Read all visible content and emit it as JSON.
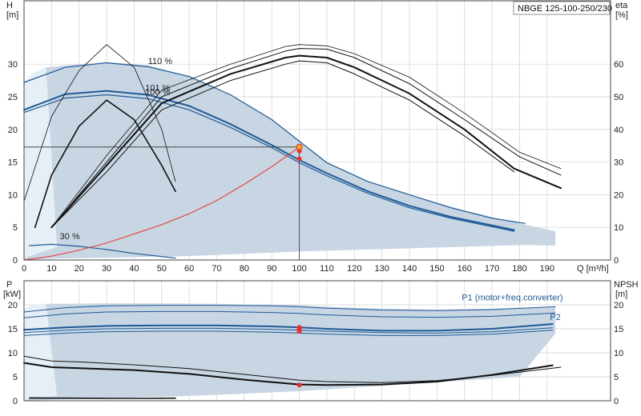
{
  "title": "NBGE 125-100-250/230",
  "colors": {
    "band_fill": "#c8d6e4",
    "band_light": "#e6eef6",
    "blue": "#1f5a96",
    "black": "#111111",
    "red": "#e8302a",
    "grid": "#d0d0d0",
    "op_point": "#f0b020"
  },
  "chart_data": [
    {
      "type": "line",
      "panel": "head_eta",
      "xlabel": "Q [m³/h]",
      "ylabel_left": [
        "H",
        "[m]"
      ],
      "ylabel_right": [
        "eta",
        "[%]"
      ],
      "xlim": [
        0,
        95
      ],
      "ylim_left": [
        0,
        39.7
      ],
      "ylim_right": [
        0,
        79.4
      ],
      "x_ticks": [
        0,
        10,
        20,
        30,
        40,
        50,
        60,
        70,
        80,
        90,
        100,
        110,
        120,
        130,
        140,
        150,
        160,
        170,
        180,
        190
      ],
      "y_ticks_left": [
        0,
        5,
        10,
        15,
        20,
        25,
        30
      ],
      "y_ticks_right": [
        0,
        10,
        20,
        30,
        40,
        50,
        60
      ],
      "grid": true,
      "curve_labels": [
        {
          "text": "110 %",
          "x": 45,
          "y": 30.0
        },
        {
          "text": "101 %",
          "x": 44,
          "y": 25.9
        },
        {
          "text": "100 %",
          "x": 44,
          "y": 25.3
        },
        {
          "text": "30 %",
          "x": 13,
          "y": 3.2
        }
      ],
      "operating_point": {
        "x": 100,
        "y": 17.3
      },
      "duty_markers": [
        {
          "x": 100,
          "y": 16.7
        },
        {
          "x": 100,
          "y": 15.5
        }
      ],
      "series": [
        {
          "role": "band",
          "x": [
            0,
            3,
            8,
            15,
            30,
            45,
            60,
            75,
            90,
            100,
            110,
            125,
            140,
            160,
            180,
            193,
            193,
            182,
            100,
            60,
            10,
            5,
            0
          ],
          "y": [
            27.2,
            28.5,
            29.5,
            29.8,
            30.3,
            29.8,
            28.2,
            25.3,
            21.5,
            18.2,
            14.9,
            12.0,
            10.0,
            7.6,
            5.6,
            4.4,
            2.2,
            2.3,
            1.3,
            0.6,
            0.2,
            0.1,
            0
          ]
        },
        {
          "role": "band_light",
          "x": [
            0,
            3,
            8,
            12,
            0
          ],
          "y": [
            27.2,
            28.5,
            29.5,
            2.0,
            0.3
          ]
        },
        {
          "role": "head",
          "color": "blue",
          "width": 1.2,
          "x": [
            0,
            15,
            30,
            45,
            60,
            75,
            90,
            100,
            110,
            125,
            140,
            155,
            170,
            182
          ],
          "y": [
            27.2,
            29.5,
            30.2,
            29.6,
            28.1,
            25.3,
            21.5,
            18.2,
            14.9,
            12.0,
            10.0,
            8.0,
            6.4,
            5.6
          ]
        },
        {
          "role": "head",
          "color": "blue",
          "width": 2.0,
          "x": [
            0,
            15,
            30,
            45,
            60,
            75,
            90,
            100,
            110,
            125,
            140,
            155,
            170,
            178
          ],
          "y": [
            23.0,
            25.4,
            25.9,
            25.3,
            23.6,
            20.8,
            17.6,
            15.3,
            13.3,
            10.5,
            8.3,
            6.6,
            5.3,
            4.6
          ]
        },
        {
          "role": "head",
          "color": "blue",
          "width": 1.2,
          "x": [
            0,
            15,
            30,
            45,
            60,
            75,
            90,
            100,
            110,
            125,
            140,
            155,
            170,
            178
          ],
          "y": [
            22.6,
            24.8,
            25.3,
            24.7,
            23.0,
            20.3,
            17.2,
            14.9,
            12.9,
            10.2,
            8.0,
            6.4,
            5.1,
            4.4
          ]
        },
        {
          "role": "head",
          "color": "blue",
          "width": 1.2,
          "x": [
            2,
            10,
            20,
            30,
            40,
            55
          ],
          "y": [
            2.2,
            2.4,
            2.1,
            1.6,
            1.0,
            0.3
          ]
        },
        {
          "role": "eta",
          "color": "black",
          "width": 0.8,
          "x": [
            0,
            10,
            20,
            30,
            40,
            50,
            55
          ],
          "y": [
            9.0,
            22.0,
            29.0,
            33.0,
            29.5,
            20.0,
            12.0
          ]
        },
        {
          "role": "eta",
          "color": "black",
          "width": 1.6,
          "x": [
            4,
            10,
            20,
            30,
            40,
            50,
            55
          ],
          "y": [
            5.0,
            13.0,
            20.5,
            24.5,
            21.5,
            14.5,
            10.5
          ]
        },
        {
          "role": "eta",
          "color": "black",
          "width": 0.8,
          "x": [
            10,
            30,
            50,
            75,
            95,
            100,
            110,
            120,
            140,
            160,
            180,
            195
          ],
          "y": [
            5.0,
            16.0,
            26.0,
            30.0,
            32.7,
            33.0,
            32.8,
            31.6,
            28.0,
            22.5,
            16.5,
            14.0
          ]
        },
        {
          "role": "eta",
          "color": "black",
          "width": 1.0,
          "x": [
            10,
            30,
            50,
            75,
            95,
            100,
            110,
            120,
            140,
            160,
            180,
            195
          ],
          "y": [
            5.0,
            15.0,
            25.0,
            29.3,
            32.0,
            32.4,
            32.3,
            31.0,
            27.0,
            21.5,
            15.8,
            13.0
          ]
        },
        {
          "role": "eta",
          "color": "black",
          "width": 2.0,
          "x": [
            10,
            30,
            50,
            75,
            95,
            100,
            110,
            120,
            140,
            160,
            178,
            195
          ],
          "y": [
            5.0,
            14.5,
            24.0,
            28.5,
            31.0,
            31.3,
            31.0,
            29.5,
            25.5,
            20.0,
            14.0,
            11.0
          ]
        },
        {
          "role": "eta",
          "color": "black",
          "width": 1.0,
          "x": [
            10,
            30,
            50,
            75,
            95,
            100,
            110,
            120,
            140,
            160,
            178
          ],
          "y": [
            5.0,
            13.5,
            23.0,
            27.5,
            30.0,
            30.5,
            30.2,
            28.5,
            24.5,
            19.0,
            13.5
          ]
        },
        {
          "role": "system",
          "color": "red",
          "width": 1.0,
          "x": [
            0,
            10,
            20,
            30,
            40,
            50,
            60,
            70,
            80,
            90,
            100
          ],
          "y": [
            0,
            0.6,
            1.5,
            2.6,
            4.0,
            5.4,
            7.1,
            9.1,
            11.6,
            14.3,
            17.3
          ]
        }
      ]
    },
    {
      "type": "line",
      "panel": "power_npsh",
      "xlabel": "Q [m³/h]",
      "ylabel_left": [
        "P",
        "[kW]"
      ],
      "ylabel_right": [
        "NPSH",
        "[m]"
      ],
      "xlim": [
        0,
        95
      ],
      "ylim_left": [
        0,
        25
      ],
      "ylim_right": [
        0,
        25
      ],
      "y_ticks_left": [
        0,
        5,
        10,
        15,
        20
      ],
      "y_ticks_right": [
        0,
        5,
        10,
        15,
        20
      ],
      "grid": true,
      "curve_labels": [
        {
          "text": "P1 (motor+freq.converter)",
          "x": 159,
          "y": 20.9
        },
        {
          "text": "P2",
          "x": 191,
          "y": 16.8
        }
      ],
      "duty_markers": [
        {
          "x": 100,
          "y": 15.3
        },
        {
          "x": 100,
          "y": 14.9
        },
        {
          "x": 100,
          "y": 14.5
        },
        {
          "x": 100,
          "y": 3.3
        }
      ],
      "series": [
        {
          "role": "band",
          "x": [
            0,
            3,
            8,
            15,
            30,
            50,
            70,
            90,
            100,
            110,
            130,
            150,
            170,
            193,
            193,
            180,
            100,
            60,
            10,
            0
          ],
          "y": [
            19.0,
            20.0,
            20.2,
            20.2,
            20.3,
            20.3,
            20.2,
            20.0,
            19.9,
            19.6,
            19.2,
            19.0,
            19.2,
            19.6,
            14.0,
            5.0,
            2.0,
            1.0,
            0.2,
            0
          ]
        },
        {
          "role": "band_light",
          "x": [
            0,
            3,
            8,
            12,
            0
          ],
          "y": [
            19.0,
            20.0,
            20.2,
            1.0,
            0.2
          ]
        },
        {
          "role": "power",
          "color": "blue",
          "width": 1.0,
          "x": [
            0,
            15,
            30,
            50,
            70,
            90,
            100,
            110,
            130,
            150,
            170,
            193
          ],
          "y": [
            18.5,
            19.4,
            19.8,
            19.9,
            19.9,
            19.8,
            19.6,
            19.3,
            18.9,
            18.8,
            19.0,
            19.6
          ]
        },
        {
          "role": "power",
          "color": "blue",
          "width": 1.0,
          "x": [
            0,
            15,
            30,
            50,
            70,
            90,
            100,
            110,
            130,
            150,
            170,
            193
          ],
          "y": [
            17.3,
            18.1,
            18.5,
            18.6,
            18.6,
            18.4,
            18.2,
            17.9,
            17.5,
            17.4,
            17.6,
            18.3
          ]
        },
        {
          "role": "power",
          "color": "blue",
          "width": 2.0,
          "x": [
            0,
            15,
            30,
            50,
            70,
            90,
            100,
            110,
            130,
            150,
            170,
            192
          ],
          "y": [
            14.8,
            15.3,
            15.6,
            15.7,
            15.7,
            15.5,
            15.3,
            15.0,
            14.6,
            14.6,
            15.0,
            16.0
          ]
        },
        {
          "role": "power",
          "color": "blue",
          "width": 1.0,
          "x": [
            0,
            15,
            30,
            50,
            70,
            90,
            100,
            110,
            130,
            150,
            170,
            192
          ],
          "y": [
            14.2,
            14.7,
            15.0,
            15.1,
            15.1,
            14.9,
            14.7,
            14.5,
            14.2,
            14.1,
            14.4,
            15.2
          ]
        },
        {
          "role": "power",
          "color": "blue",
          "width": 1.0,
          "x": [
            0,
            15,
            30,
            50,
            70,
            90,
            100,
            110,
            130,
            150,
            170,
            192
          ],
          "y": [
            13.6,
            14.1,
            14.4,
            14.5,
            14.5,
            14.3,
            14.1,
            13.9,
            13.6,
            13.6,
            13.9,
            14.7
          ]
        },
        {
          "role": "power",
          "color": "blue",
          "width": 1.0,
          "x": [
            2,
            15,
            30,
            45,
            55
          ],
          "y": [
            0.5,
            0.5,
            0.5,
            0.5,
            0.5
          ]
        },
        {
          "role": "npsh",
          "color": "black",
          "width": 1.0,
          "x": [
            0,
            10,
            20,
            40,
            60,
            80,
            100,
            110,
            130,
            150,
            170,
            195
          ],
          "y": [
            9.3,
            8.3,
            8.1,
            7.5,
            6.7,
            5.5,
            4.3,
            4.0,
            3.8,
            4.2,
            5.3,
            7.0
          ]
        },
        {
          "role": "npsh",
          "color": "black",
          "width": 2.0,
          "x": [
            0,
            10,
            20,
            40,
            60,
            80,
            100,
            110,
            130,
            150,
            170,
            192
          ],
          "y": [
            7.9,
            7.0,
            6.8,
            6.4,
            5.6,
            4.4,
            3.4,
            3.3,
            3.4,
            4.0,
            5.4,
            7.4
          ]
        },
        {
          "role": "npsh",
          "color": "black",
          "width": 1.6,
          "x": [
            2,
            15,
            30,
            45,
            55
          ],
          "y": [
            0.6,
            0.55,
            0.5,
            0.5,
            0.55
          ]
        }
      ]
    }
  ]
}
